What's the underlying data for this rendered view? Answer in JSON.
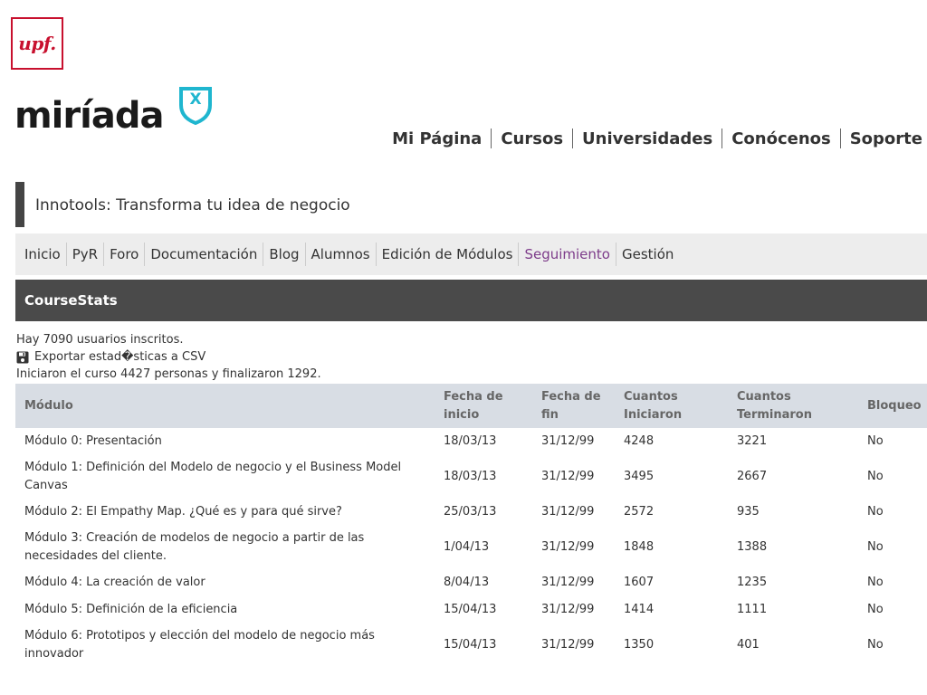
{
  "brand": {
    "upf": "upf.",
    "miriada": "miríada",
    "miriada_x": "X",
    "accent": "#1fb6cf",
    "upf_red": "#c8102e"
  },
  "top_nav": [
    "Mi Página",
    "Cursos",
    "Universidades",
    "Conócenos",
    "Soporte"
  ],
  "course_title": "Innotools: Transforma tu idea de negocio",
  "sub_nav": {
    "items": [
      "Inicio",
      "PyR",
      "Foro",
      "Documentación",
      "Blog",
      "Alumnos",
      "Edición de Módulos",
      "Seguimiento",
      "Gestión"
    ],
    "active": "Seguimiento",
    "active_color": "#7d3c8a"
  },
  "section_title": "CourseStats",
  "info": {
    "enrolled": "Hay 7090 usuarios inscritos.",
    "export": "Exportar estad�sticas a CSV",
    "export_icon": "floppy-disk-icon",
    "summary": "Iniciaron el curso 4427 personas y finalizaron 1292."
  },
  "table": {
    "headers": [
      "Módulo",
      "Fecha de inicio",
      "Fecha de fin",
      "Cuantos Iniciaron",
      "Cuantos Terminaron",
      "Bloqueo"
    ],
    "rows": [
      [
        "Módulo 0: Presentación",
        "18/03/13",
        "31/12/99",
        "4248",
        "3221",
        "No"
      ],
      [
        "Módulo 1: Definición del Modelo de negocio y el Business Model Canvas",
        "18/03/13",
        "31/12/99",
        "3495",
        "2667",
        "No"
      ],
      [
        "Módulo 2: El Empathy Map. ¿Qué es y para qué sirve?",
        "25/03/13",
        "31/12/99",
        "2572",
        "935",
        "No"
      ],
      [
        "Módulo 3: Creación de modelos de negocio a partir de las necesidades del cliente.",
        "1/04/13",
        "31/12/99",
        "1848",
        "1388",
        "No"
      ],
      [
        "Módulo 4: La creación de valor",
        "8/04/13",
        "31/12/99",
        "1607",
        "1235",
        "No"
      ],
      [
        "Módulo 5: Definición de la eficiencia",
        "15/04/13",
        "31/12/99",
        "1414",
        "1111",
        "No"
      ],
      [
        "Módulo 6: Prototipos y elección del modelo de negocio más innovador",
        "15/04/13",
        "31/12/99",
        "1350",
        "401",
        "No"
      ]
    ]
  }
}
